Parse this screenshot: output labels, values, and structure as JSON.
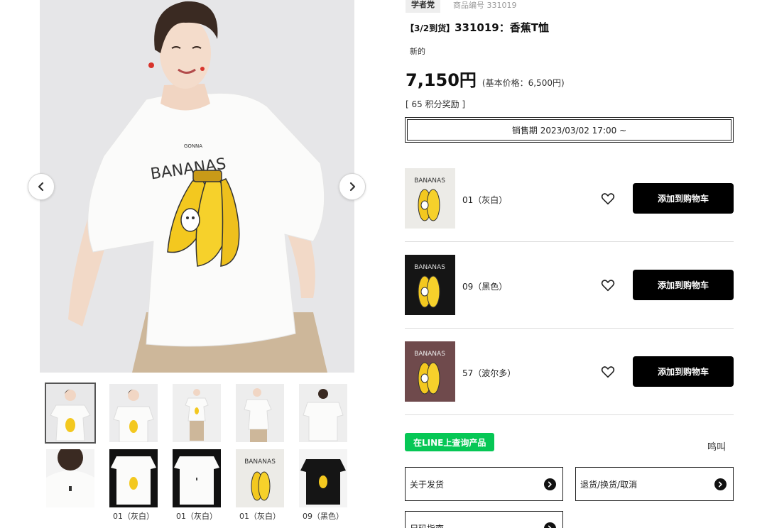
{
  "gallery": {
    "prev_icon": "chevron-left-icon",
    "next_icon": "chevron-right-icon",
    "shirt_print_text": "BANANAS",
    "shirt_print_small": "GONNA",
    "thumbnails": [
      {
        "caption": "",
        "selected": true
      },
      {
        "caption": "",
        "selected": false
      },
      {
        "caption": "",
        "selected": false
      },
      {
        "caption": "",
        "selected": false
      },
      {
        "caption": "",
        "selected": false
      },
      {
        "caption": "",
        "selected": false
      },
      {
        "caption": "01（灰白）",
        "selected": false
      },
      {
        "caption": "01（灰白）",
        "selected": false
      },
      {
        "caption": "01（灰白）",
        "selected": false
      },
      {
        "caption": "09（黑色）",
        "selected": false
      }
    ]
  },
  "product": {
    "brand": "学者党",
    "code_label": "商品编号 331019",
    "title_prefix": "【3/2到货】",
    "title": "331019：香蕉T恤",
    "condition": "新的",
    "price": "7,150円",
    "base_price": "(基本价格：6,500円)",
    "points": "[ 65 积分奖励 ]",
    "sale_period": "销售期 2023/03/02 17:00 ~"
  },
  "variants": [
    {
      "name": "01（灰白）",
      "cart_label": "添加到购物车",
      "bg": "#ecebe7",
      "fav_icon": "heart-icon"
    },
    {
      "name": "09（黑色）",
      "cart_label": "添加到购物车",
      "bg": "#151515",
      "fav_icon": "heart-icon"
    },
    {
      "name": "57（波尔多）",
      "cart_label": "添加到购物车",
      "bg": "#6f4a4c",
      "fav_icon": "heart-icon"
    }
  ],
  "line": {
    "button_label": "在LINE上查询产品",
    "chirp": "鸣叫",
    "color": "#06c755"
  },
  "links": [
    {
      "label": "关于发货"
    },
    {
      "label": "退货/换货/取消"
    },
    {
      "label": "尺码指南"
    }
  ]
}
